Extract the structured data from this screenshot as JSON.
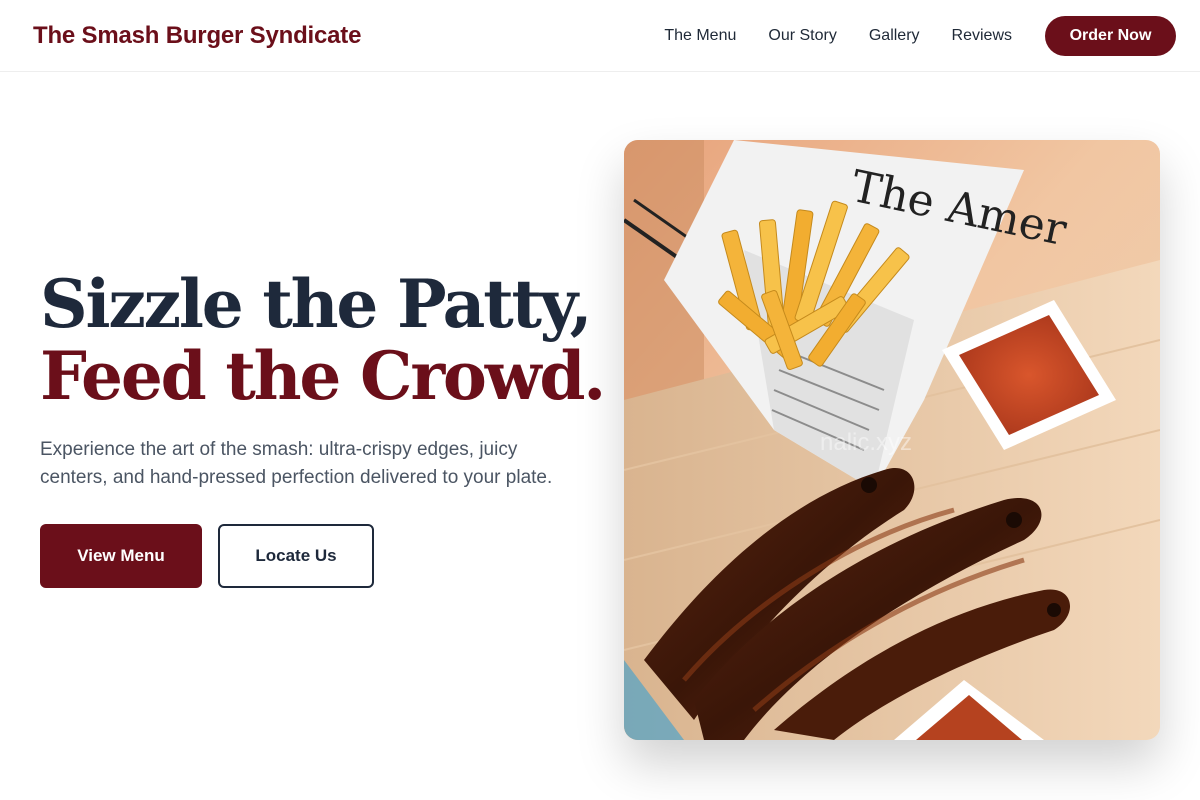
{
  "header": {
    "brand": "The Smash Burger Syndicate",
    "nav": [
      "The Menu",
      "Our Story",
      "Gallery",
      "Reviews"
    ],
    "order_button": "Order Now"
  },
  "hero": {
    "headline_line1": "Sizzle the Patty,",
    "headline_line2": "Feed the Crowd.",
    "subtitle": "Experience the art of the smash: ultra-crispy edges, juicy centers, and hand-pressed perfection delivered to your plate.",
    "primary_cta": "View Menu",
    "secondary_cta": "Locate Us",
    "image": {
      "watermark": "nalic.xyz",
      "newspaper_text": "The Amer"
    }
  },
  "colors": {
    "brand": "#6b0f1a",
    "navy": "#1e293b",
    "body_text": "#4b5563"
  }
}
